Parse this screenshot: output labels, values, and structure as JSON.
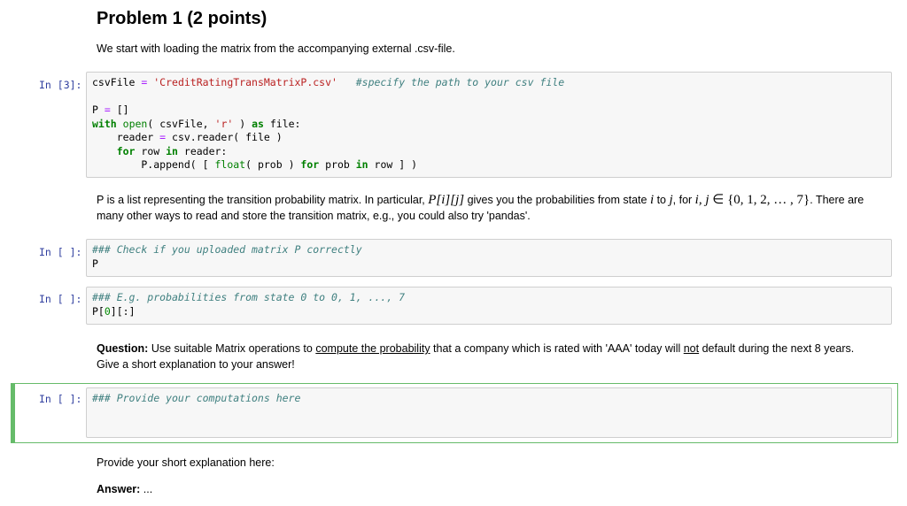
{
  "heading": "Problem 1 (2 points)",
  "intro": "We start with loading the matrix from the accompanying external .csv-file.",
  "cells": [
    {
      "prompt": "In [3]:",
      "lines": {
        "l1_var": "csvFile",
        "l1_eq": " = ",
        "l1_str": "'CreditRatingTransMatrixP.csv'",
        "l1_comment": "   #specify the path to your csv file",
        "l3_var": "P",
        "l3_eq": " = ",
        "l3_rest": "[]",
        "l4_kw1": "with",
        "l4_bi": "open",
        "l4_a": "( csvFile, ",
        "l4_str": "'r'",
        "l4_b": " ) ",
        "l4_kw2": "as",
        "l4_c": " file:",
        "l5_a": "    reader ",
        "l5_eq": "=",
        "l5_b": " csv.reader( file )",
        "l6_kw1": "for",
        "l6_a": " row ",
        "l6_kw2": "in",
        "l6_b": " reader:",
        "l7_a": "        P.append( [ ",
        "l7_bi": "float",
        "l7_b": "( prob ) ",
        "l7_kw1": "for",
        "l7_c": " prob ",
        "l7_kw2": "in",
        "l7_d": " row ] )"
      }
    },
    {
      "prompt": "In [ ]:",
      "comment": "### Check if you uploaded matrix P correctly",
      "code": "P"
    },
    {
      "prompt": "In [ ]:",
      "comment": "### E.g. probabilities from state 0 to 0, 1, ..., 7",
      "code_a": "P[",
      "code_num": "0",
      "code_b": "][:]"
    },
    {
      "prompt": "In [ ]:",
      "comment": "### Provide your computations here",
      "selected": true
    }
  ],
  "para": {
    "t1": "P is a list representing the transition probability matrix. In particular, ",
    "m1": "P[i][j]",
    "t2": " gives you the probabilities from state ",
    "m2": "i",
    "t3": " to ",
    "m3": "j",
    "t4": ", for ",
    "m4": "i, j",
    "m5": " ∈ {0, 1, 2, … , 7}",
    "t5": ". There are",
    "line2": "many other ways to read and store the transition matrix, e.g., you could also try 'pandas'."
  },
  "question": {
    "label": "Question:",
    "t1": " Use suitable Matrix operations to ",
    "u1": "compute the probability",
    "t2": " that a company which is rated with 'AAA' today will ",
    "u2": "not",
    "t3": " default during the next 8 years.",
    "line2": "Give a short explanation to your answer!"
  },
  "explanation_prompt": "Provide your short explanation here:",
  "answer": {
    "label": "Answer:",
    "value": " ..."
  },
  "colors": {
    "prompt": "#303f9f",
    "selected_border": "#66bb6a",
    "cell_bg": "#f7f7f7",
    "keyword": "#008000",
    "string": "#ba2121",
    "comment": "#408080",
    "operator": "#aa22ff"
  }
}
